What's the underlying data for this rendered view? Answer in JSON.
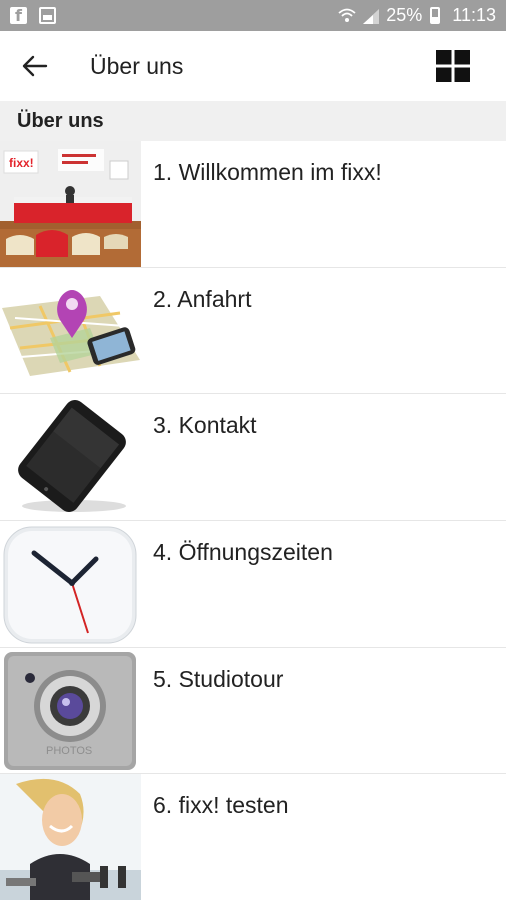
{
  "status_bar": {
    "battery": "25%",
    "time": "11:13",
    "icons": [
      "facebook-icon",
      "image-icon",
      "wifi-icon",
      "signal-icon",
      "battery-icon"
    ]
  },
  "app_bar": {
    "title": "Über uns",
    "back_icon": "arrow-left-icon",
    "grid_icon": "grid-view-icon"
  },
  "section_header": "Über uns",
  "items": [
    {
      "label": "1. Willkommen im fixx!",
      "thumb": "reception-photo"
    },
    {
      "label": "2. Anfahrt",
      "thumb": "map-with-pin-and-phone"
    },
    {
      "label": "3. Kontakt",
      "thumb": "smartphone"
    },
    {
      "label": "4. Öffnungszeiten",
      "thumb": "clock"
    },
    {
      "label": "5. Studiotour",
      "thumb": "camera-app-icon"
    },
    {
      "label": "6. fixx! testen",
      "thumb": "woman-exercising-photo"
    }
  ],
  "colors": {
    "status_bar": "#9e9e9e",
    "section_header_bg": "#f0f0f0",
    "brand_red": "#e3242b"
  }
}
